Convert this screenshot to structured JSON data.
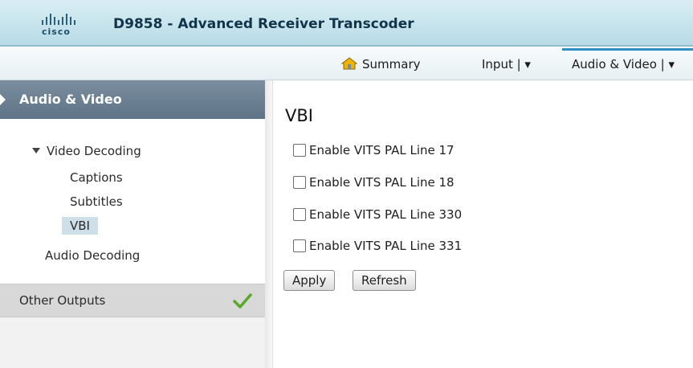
{
  "header": {
    "logo_text": "cisco",
    "app_title": "D9858 - Advanced Receiver Transcoder"
  },
  "nav": {
    "summary": "Summary",
    "input": "Input | ▾",
    "audio_video": "Audio & Video | ▾",
    "summary_icon": "home-icon"
  },
  "sidebar": {
    "header": "Audio & Video",
    "video_decoding": "Video Decoding",
    "captions": "Captions",
    "subtitles": "Subtitles",
    "vbi": "VBI",
    "audio_decoding": "Audio Decoding",
    "other_outputs": "Other Outputs",
    "other_outputs_status_icon": "checkmark-icon"
  },
  "main": {
    "title": "VBI",
    "checkboxes": [
      {
        "label": "Enable VITS PAL Line 17",
        "checked": false
      },
      {
        "label": "Enable VITS PAL Line 18",
        "checked": false
      },
      {
        "label": "Enable VITS PAL Line 330",
        "checked": false
      },
      {
        "label": "Enable VITS PAL Line 331",
        "checked": false
      }
    ],
    "apply_label": "Apply",
    "refresh_label": "Refresh"
  },
  "colors": {
    "header_bg": "#c8e4ed",
    "sidebar_header_bg": "#6b7f92",
    "selected_bg": "#cfdfe9",
    "accent": "#2f8fc1",
    "check_green": "#5aa82c"
  }
}
